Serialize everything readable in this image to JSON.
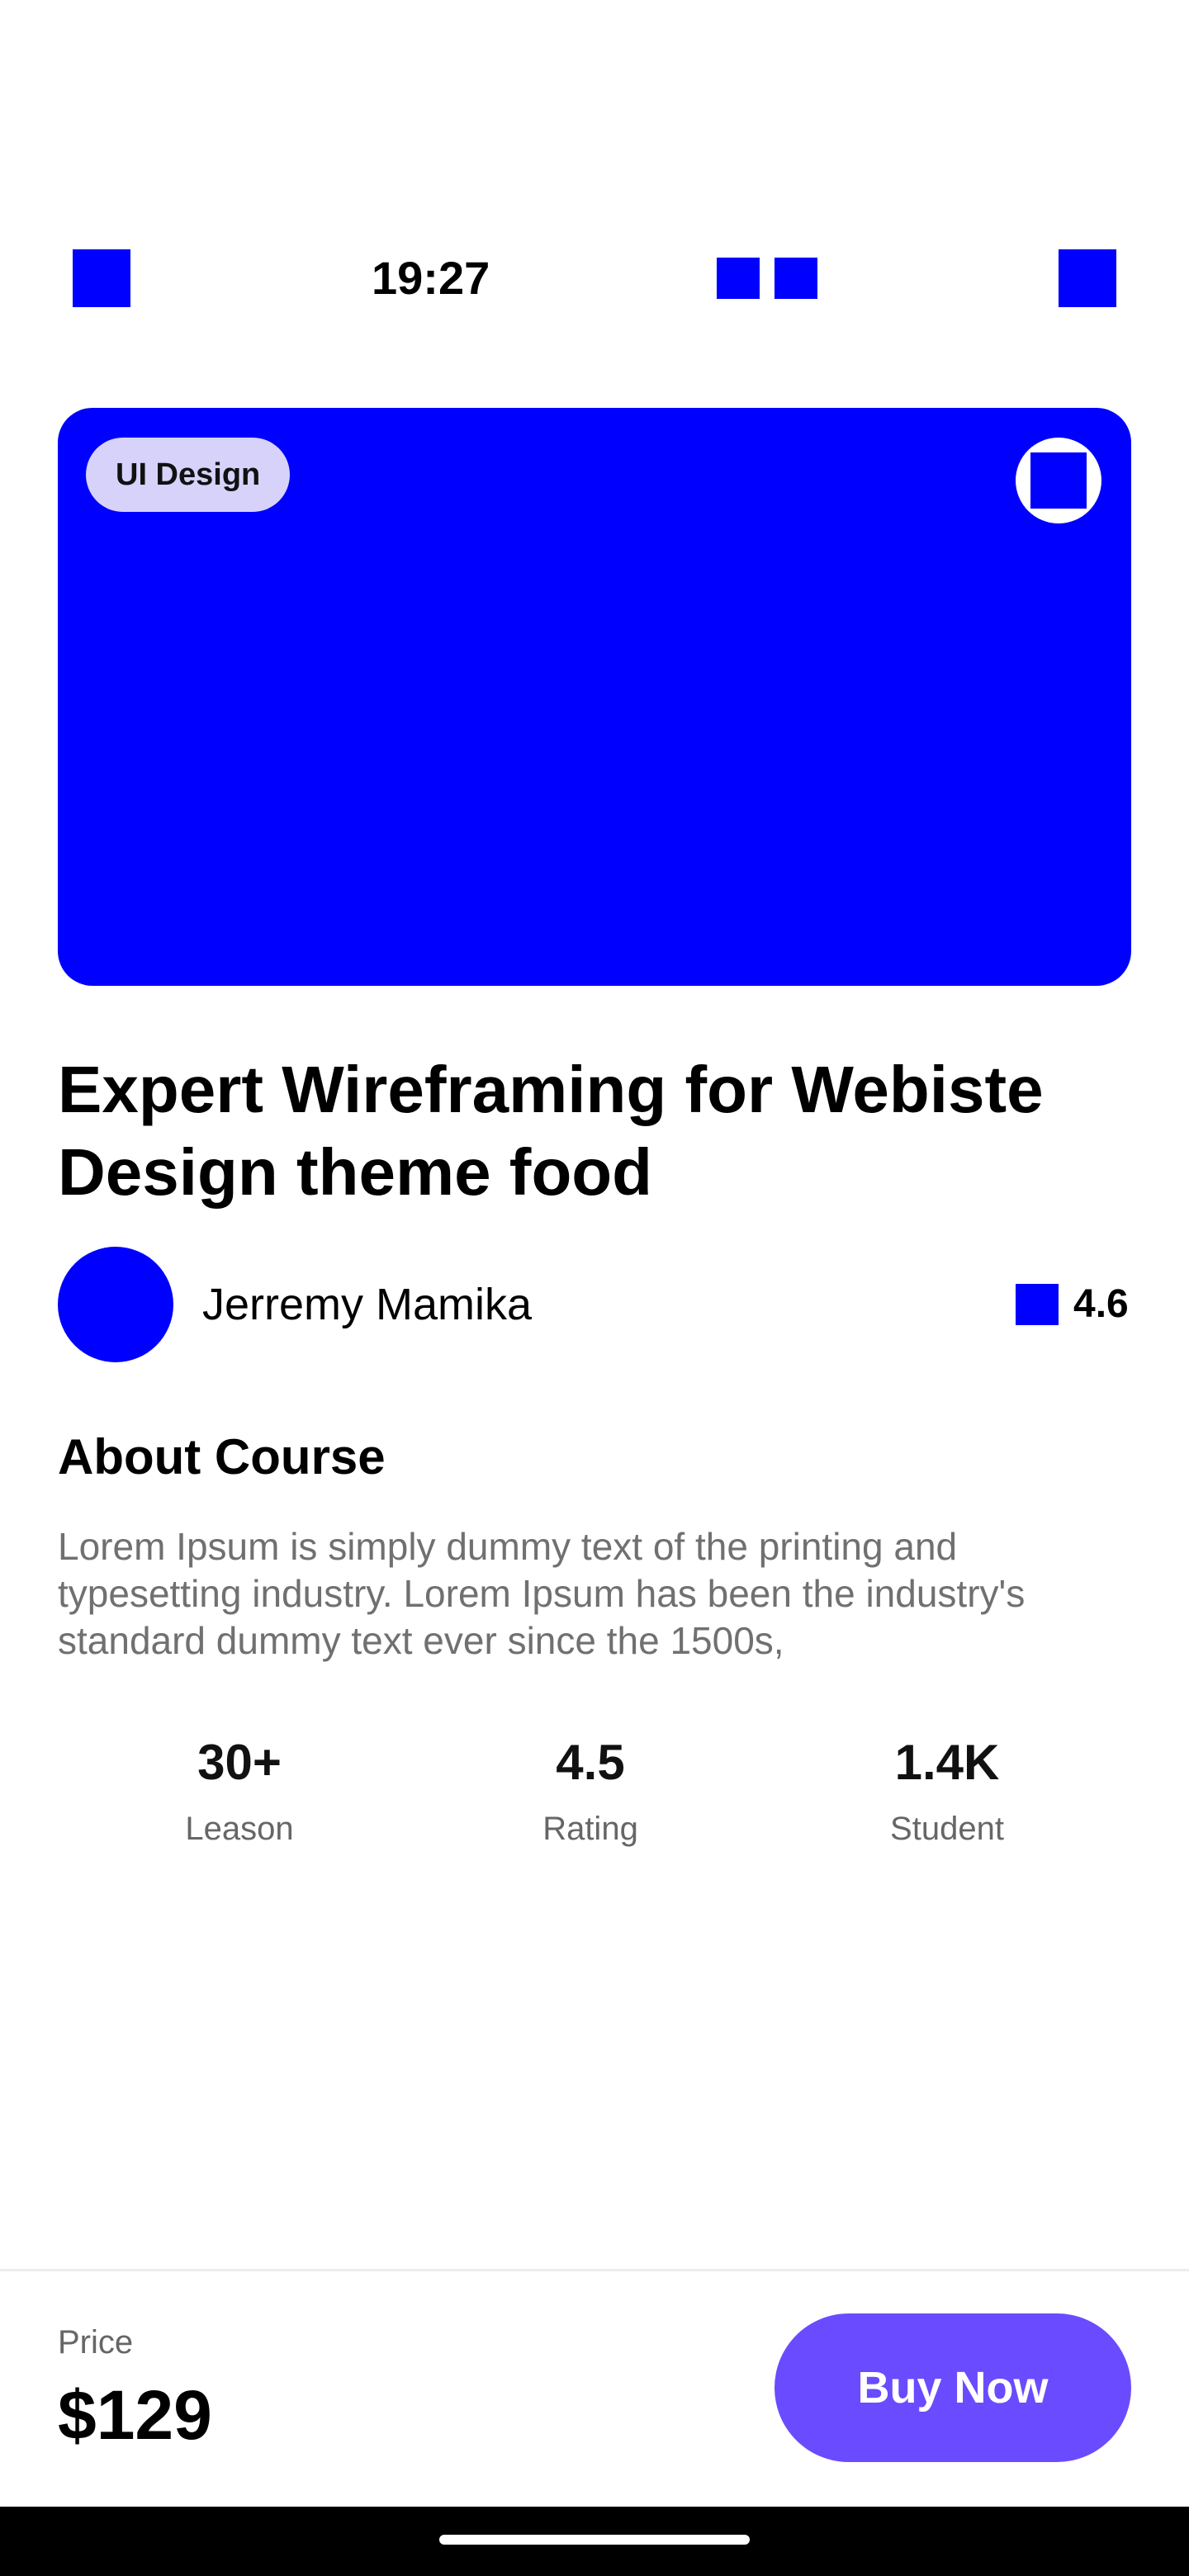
{
  "status_bar": {
    "time": "19:27",
    "left_icon": "square-icon",
    "middle_icons": [
      "square-icon",
      "square-icon"
    ],
    "right_icon": "square-icon",
    "icon_color": "#0000ff"
  },
  "hero": {
    "tag": "UI Design",
    "bookmark_icon": "bookmark-icon",
    "image_color": "#0000ff"
  },
  "course": {
    "title": "Expert Wireframing for Webiste Design theme food",
    "instructor": "Jerremy Mamika",
    "rating": "4.6",
    "rating_icon": "star-icon"
  },
  "about": {
    "heading": "About Course",
    "body": "Lorem Ipsum is simply dummy text of the printing and typesetting industry. Lorem Ipsum has been the industry's standard dummy text ever since the 1500s,"
  },
  "stats": [
    {
      "value": "30+",
      "label": "Leason"
    },
    {
      "value": "4.5",
      "label": "Rating"
    },
    {
      "value": "1.4K",
      "label": "Student"
    }
  ],
  "footer": {
    "price_label": "Price",
    "price": "$129",
    "buy_label": "Buy Now",
    "button_color": "#6a4bff"
  }
}
